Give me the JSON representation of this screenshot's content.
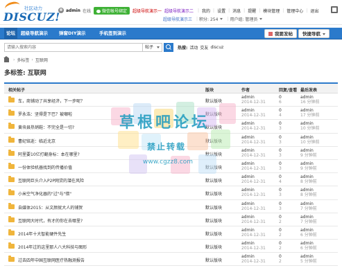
{
  "brand": {
    "logo_text": "DISCUZ!",
    "sub_text": "社区动力"
  },
  "userbar": {
    "username": "admin",
    "status": "在线",
    "wechat": "微信帐号绑定",
    "promo1": "超级导航演示一",
    "promo2": "超级导航演示二",
    "links": [
      "我的",
      "设置",
      "消息",
      "提醒",
      "模块管理",
      "管理中心",
      "退出"
    ]
  },
  "credits": {
    "promo3": "超级导航演示三",
    "label": "积分: 254",
    "group": "用户组: 管理员"
  },
  "nav": {
    "items": [
      "论坛",
      "超级导航演示",
      "弹窗DIY演示",
      "手机签到演示"
    ],
    "post_button": "我要发帖",
    "quick_button": "快捷导航"
  },
  "search": {
    "placeholder": "请输入搜索内容",
    "type": "帖子",
    "hot_label": "热搜:",
    "hot_words": [
      "活动",
      "交友",
      "discuz"
    ]
  },
  "breadcrumb": {
    "items": [
      "多标签",
      "互联网"
    ]
  },
  "page_title": "多标签: 互联网",
  "table": {
    "headers": [
      "相关帖子",
      "版块",
      "作者",
      "回复/查看",
      "最后发表"
    ],
    "rows": [
      {
        "title": "车，商铺动了共享经济，下一步呢？",
        "forum": "默认版块",
        "author": "admin",
        "date": "2014-12-31",
        "replies": "0",
        "views": "6",
        "last_author": "admin",
        "last_time": "16 分钟前"
      },
      {
        "title": "罗永浩：坚得是下巴？被嘲啦",
        "forum": "默认版块",
        "author": "admin",
        "date": "2014-12-31",
        "replies": "0",
        "views": "4",
        "last_author": "admin",
        "last_time": "17 分钟前"
      },
      {
        "title": "黄块县热销鞋：不完全是一切?",
        "forum": "默认版块",
        "author": "admin",
        "date": "2014-12-31",
        "replies": "0",
        "views": "3",
        "last_author": "admin",
        "last_time": "10 分钟前"
      },
      {
        "title": "曹纪铭逝：临近北京",
        "forum": "默认版块",
        "author": "admin",
        "date": "2014-12-31",
        "replies": "0",
        "views": "3",
        "last_author": "admin",
        "last_time": "10 分钟前"
      },
      {
        "title": "阿里要10亿打翻身标：本在哪里?",
        "forum": "默认版块",
        "author": "admin",
        "date": "2014-12-31",
        "replies": "0",
        "views": "3",
        "last_author": "admin",
        "last_time": "9 分钟前"
      },
      {
        "title": "一份体验机器找到的传播价值",
        "forum": "默认版块",
        "author": "admin",
        "date": "2014-12-31",
        "replies": "0",
        "views": "3",
        "last_author": "admin",
        "last_time": "9 分钟前"
      },
      {
        "title": "互联网巨头介入P2P网贷的潜在风险",
        "forum": "默认版块",
        "author": "admin",
        "date": "2014-12-31",
        "replies": "0",
        "views": "4",
        "last_author": "admin",
        "last_time": "8 分钟前"
      },
      {
        "title": "小米空气净化器的\"过\"与\"错\"",
        "forum": "默认版块",
        "author": "admin",
        "date": "2014-12-31",
        "replies": "0",
        "views": "3",
        "last_author": "admin",
        "last_time": "8 分钟前"
      },
      {
        "title": "自媒体2015：从文颜就大人的铺贺",
        "forum": "默认版块",
        "author": "admin",
        "date": "2014-12-31",
        "replies": "0",
        "views": "3",
        "last_author": "admin",
        "last_time": "7 分钟前"
      },
      {
        "title": "互联网大时代，有才的你在去哪里?",
        "forum": "默认版块",
        "author": "admin",
        "date": "2014-12-31",
        "replies": "0",
        "views": "2",
        "last_author": "admin",
        "last_time": "7 分钟前"
      },
      {
        "title": "2014年十大智能硬件先生",
        "forum": "默认版块",
        "author": "admin",
        "date": "2014-12-31",
        "replies": "0",
        "views": "2",
        "last_author": "admin",
        "last_time": "6 分钟前"
      },
      {
        "title": "2014年过的这里那人八大科技与图形",
        "forum": "默认版块",
        "author": "admin",
        "date": "2014-12-31",
        "replies": "0",
        "views": "2",
        "last_author": "admin",
        "last_time": "6 分钟前"
      },
      {
        "title": "过去四年中国互联网医疗热融测报告",
        "forum": "默认版块",
        "author": "admin",
        "date": "2014-12-31",
        "replies": "0",
        "views": "2",
        "last_author": "admin",
        "last_time": "5 分钟前"
      }
    ]
  },
  "watermark": {
    "line1": "草根吧论坛",
    "line2": "禁止转载",
    "line3": "www.cgzz8.com"
  },
  "colors": {
    "accent": "#2b7acb",
    "wechat": "#3eb135",
    "promo_red": "#cc0000",
    "promo_purple": "#7a1ac0",
    "folder": "#f0b53c",
    "watermark": "#1f9bbf"
  }
}
